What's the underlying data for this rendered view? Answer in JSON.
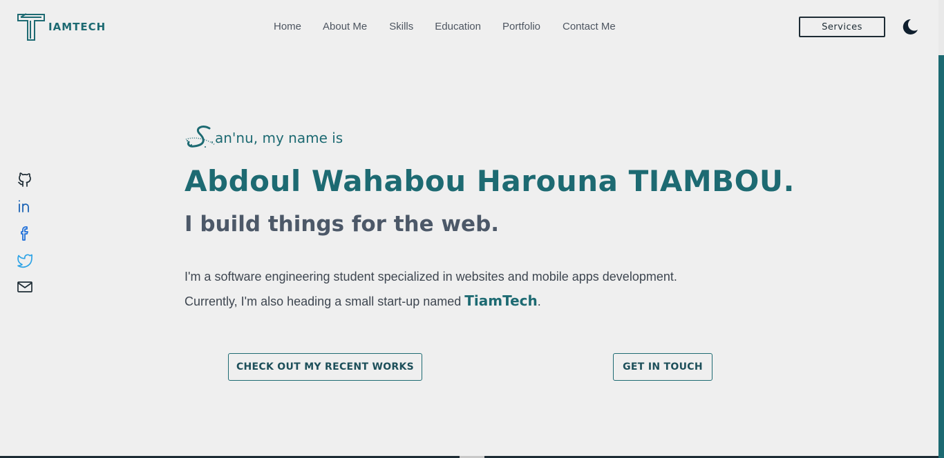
{
  "header": {
    "logo_text": "IAMTECH",
    "nav": [
      "Home",
      "About Me",
      "Skills",
      "Education",
      "Portfolio",
      "Contact Me"
    ],
    "services_label": "Services",
    "theme_icon": "moon-icon"
  },
  "social": [
    "github-icon",
    "linkedin-icon",
    "facebook-icon",
    "twitter-icon",
    "mail-icon"
  ],
  "hero": {
    "intro_rest": "an'nu, my name is",
    "name": "Abdoul Wahabou Harouna TIAMBOU.",
    "tagline": "I build things for the web.",
    "desc_line1": "I'm a software engineering student specialized in websites and mobile apps development.",
    "desc_line2_prefix": "Currently, I'm also heading a small start-up named ",
    "desc_brand": "TiamTech",
    "desc_suffix": ".",
    "btn_works": "CHECK OUT MY RECENT WORKS",
    "btn_touch": "GET IN TOUCH"
  },
  "colors": {
    "accent": "#1d6a72",
    "background": "#efefef",
    "dark": "#1d2b34"
  }
}
